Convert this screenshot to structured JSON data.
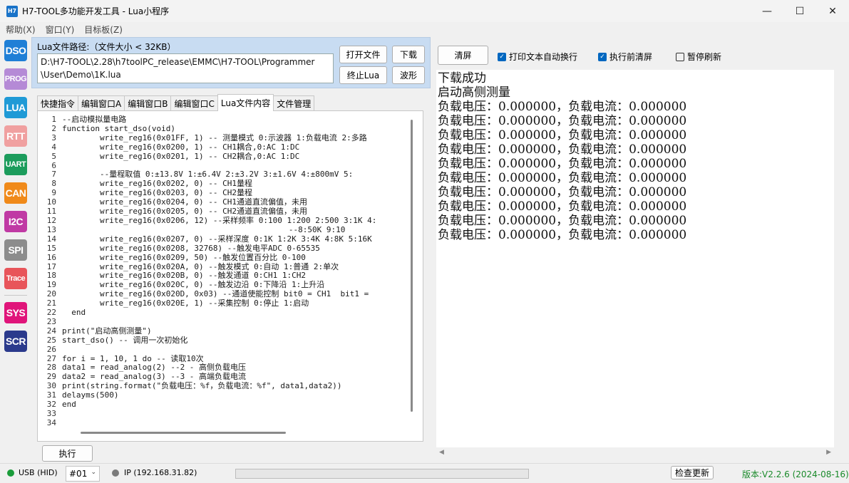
{
  "window": {
    "app_icon": "H7",
    "title": "H7-TOOL多功能开发工具 - Lua小程序",
    "minimize": "—",
    "maximize": "☐",
    "close": "✕"
  },
  "menu": [
    "帮助(X)",
    "窗口(Y)",
    "目标板(Z)"
  ],
  "iconbar": [
    {
      "label": "DSO",
      "color": "#1f7fd6"
    },
    {
      "label": "PROG",
      "color": "#b58ad6"
    },
    {
      "label": "LUA",
      "color": "#1f9ad6"
    },
    {
      "label": "RTT",
      "color": "#f0a0a0"
    },
    {
      "label": "UART",
      "color": "#1c9c5c"
    },
    {
      "label": "CAN",
      "color": "#f08a1a"
    },
    {
      "label": "I2C",
      "color": "#c03aa4"
    },
    {
      "label": "SPI",
      "color": "#8c8c8c"
    },
    {
      "label": "Trace",
      "color": "#e8555a"
    },
    {
      "label": "SYS",
      "color": "#e0157a"
    },
    {
      "label": "SCR",
      "color": "#2b3a8c"
    }
  ],
  "path_panel": {
    "label": "Lua文件路径:（文件大小 < 32KB）",
    "path": "D:\\H7-TOOL\\2.28\\h7toolPC_release\\EMMC\\H7-TOOL\\Programmer\n\\User\\Demo\\1K.lua",
    "btn_open": "打开文件",
    "btn_download": "下载",
    "btn_stop": "终止Lua",
    "btn_wave": "波形"
  },
  "tabs": [
    {
      "label": "快捷指令",
      "active": false
    },
    {
      "label": "编辑窗口A",
      "active": false
    },
    {
      "label": "编辑窗口B",
      "active": false
    },
    {
      "label": "编辑窗口C",
      "active": false
    },
    {
      "label": "Lua文件内容",
      "active": true
    },
    {
      "label": "文件管理",
      "active": false
    }
  ],
  "code_lines": [
    "--启动模拟量电路",
    "function start_dso(void)",
    "        write_reg16(0x01FF, 1) -- 测量模式 0:示波器 1:负载电流 2:多路",
    "        write_reg16(0x0200, 1) -- CH1耦合,0:AC 1:DC",
    "        write_reg16(0x0201, 1) -- CH2耦合,0:AC 1:DC",
    "",
    "        --量程取值 0:±13.8V 1:±6.4V 2:±3.2V 3:±1.6V 4:±800mV 5:",
    "        write_reg16(0x0202, 0) -- CH1量程",
    "        write_reg16(0x0203, 0) -- CH2量程",
    "        write_reg16(0x0204, 0) -- CH1通道直流偏值，未用",
    "        write_reg16(0x0205, 0) -- CH2通道直流偏值，未用",
    "        write_reg16(0x0206, 12) --采样频率 0:100 1:200 2:500 3:1K 4:",
    "                                                --8:50K 9:10",
    "        write_reg16(0x0207, 0) --采样深度 0:1K 1:2K 3:4K 4:8K 5:16K",
    "        write_reg16(0x0208, 32768) --触发电平ADC 0-65535",
    "        write_reg16(0x0209, 50) --触发位置百分比 0-100",
    "        write_reg16(0x020A, 0) --触发模式 0:自动 1:普通 2:单次",
    "        write_reg16(0x020B, 0) --触发通道 0:CH1 1:CH2",
    "        write_reg16(0x020C, 0) --触发边沿 0:下降沿 1:上升沿",
    "        write_reg16(0x020D, 0x03) --通道使能控制 bit0 = CH1  bit1 =",
    "        write_reg16(0x020E, 1) --采集控制 0:停止 1:启动",
    "  end",
    "",
    "print(\"启动高侧测量\")",
    "start_dso() -- 调用一次初始化",
    "",
    "for i = 1, 10, 1 do -- 读取10次",
    "data1 = read_analog(2) --2 - 高侧负载电压",
    "data2 = read_analog(3) --3 - 高端负载电流",
    "print(string.format(\"负载电压：%f，负载电流：%f\", data1,data2))",
    "delayms(500)",
    "end",
    "",
    ""
  ],
  "run_button": "执行",
  "right_panel": {
    "clear_button": "清屏",
    "chk_wrap": {
      "label": "打印文本自动换行",
      "checked": true
    },
    "chk_clear": {
      "label": "执行前清屏",
      "checked": true
    },
    "chk_pause": {
      "label": "暂停刷新",
      "checked": false
    }
  },
  "output_lines": [
    "下载成功",
    "启动高侧测量",
    "负载电压：0.000000，负载电流：0.000000",
    "负载电压：0.000000，负载电流：0.000000",
    "负载电压：0.000000，负载电流：0.000000",
    "负载电压：0.000000，负载电流：0.000000",
    "负载电压：0.000000，负载电流：0.000000",
    "负载电压：0.000000，负载电流：0.000000",
    "负载电压：0.000000，负载电流：0.000000",
    "负载电压：0.000000，负载电流：0.000000",
    "负载电压：0.000000，负载电流：0.000000",
    "负载电压：0.000000，负载电流：0.000000"
  ],
  "status": {
    "usb": "USB (HID)",
    "device_select": "#01",
    "ip": "IP (192.168.31.82)",
    "check_update": "检查更新",
    "version": "版本:V2.2.6 (2024-08-16)",
    "usb_color": "#1a9c3a",
    "ip_color": "#7a7a7a",
    "version_color": "#1a8a2a"
  }
}
